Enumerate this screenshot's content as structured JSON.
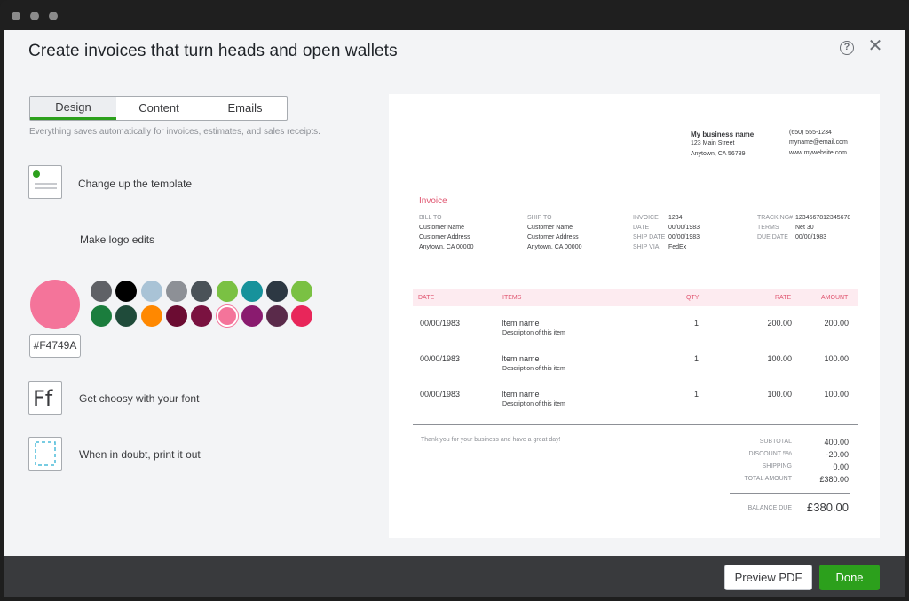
{
  "window": {
    "title": "Create invoices that turn heads and open wallets"
  },
  "tabs": [
    {
      "label": "Design",
      "active": true
    },
    {
      "label": "Content"
    },
    {
      "label": "Emails"
    }
  ],
  "autosave_note": "Everything saves automatically for invoices, estimates, and sales receipts.",
  "options": {
    "template_label": "Change up the template",
    "logo_label": "Make logo edits",
    "font_label": "Get choosy with your font",
    "print_label": "When in doubt, print it out"
  },
  "color": {
    "selected_hex": "#F4749A",
    "palette_row1": [
      "#5f6166",
      "#000000",
      "#a9c3d6",
      "#8d9096",
      "#4a5258",
      "#7ac143",
      "#17929b",
      "#2d3843",
      "#7ac143"
    ],
    "palette_row2": [
      "#1b7d3d",
      "#1f4b3a",
      "#ff8800",
      "#6b0c32",
      "#7a1240",
      "#F4749A",
      "#8a1b6f",
      "#5a2a4a",
      "#e8265a"
    ],
    "selected_index_row2": 5
  },
  "invoice": {
    "business_name": "My business name",
    "address1": "123 Main Street",
    "address2": "Anytown, CA 56789",
    "phone": "(650) 555-1234",
    "email": "myname@email.com",
    "website": "www.mywebsite.com",
    "title": "Invoice",
    "bill_to_label": "BILL TO",
    "bill_to": [
      "Customer Name",
      "Customer Address",
      "Anytown, CA 00000"
    ],
    "ship_to_label": "SHIP TO",
    "ship_to": [
      "Customer Name",
      "Customer Address",
      "Anytown, CA 00000"
    ],
    "meta": [
      {
        "label": "INVOICE",
        "value": "1234"
      },
      {
        "label": "DATE",
        "value": "00/00/1983"
      },
      {
        "label": "SHIP DATE",
        "value": "00/00/1983"
      },
      {
        "label": "SHIP VIA",
        "value": "FedEx"
      }
    ],
    "meta2": [
      {
        "label": "TRACKING#",
        "value": "1234567812345678"
      },
      {
        "label": "TERMS",
        "value": "Net 30"
      },
      {
        "label": "DUE DATE",
        "value": "00/00/1983"
      }
    ],
    "columns": {
      "date": "DATE",
      "items": "ITEMS",
      "qty": "QTY",
      "rate": "RATE",
      "amount": "AMOUNT"
    },
    "rows": [
      {
        "date": "00/00/1983",
        "item": "Item name",
        "desc": "Description of this item",
        "qty": "1",
        "rate": "200.00",
        "amount": "200.00"
      },
      {
        "date": "00/00/1983",
        "item": "Item name",
        "desc": "Description of this item",
        "qty": "1",
        "rate": "100.00",
        "amount": "100.00"
      },
      {
        "date": "00/00/1983",
        "item": "Item name",
        "desc": "Description of this item",
        "qty": "1",
        "rate": "100.00",
        "amount": "100.00"
      }
    ],
    "thanks": "Thank you for your business and have a great day!",
    "totals": [
      {
        "label": "SUBTOTAL",
        "value": "400.00"
      },
      {
        "label": "DISCOUNT 5%",
        "value": "-20.00"
      },
      {
        "label": "SHIPPING",
        "value": "0.00"
      },
      {
        "label": "TOTAL AMOUNT",
        "value": "£380.00"
      }
    ],
    "balance_label": "BALANCE DUE",
    "balance_value": "£380.00"
  },
  "footer": {
    "preview_label": "Preview PDF",
    "done_label": "Done"
  }
}
